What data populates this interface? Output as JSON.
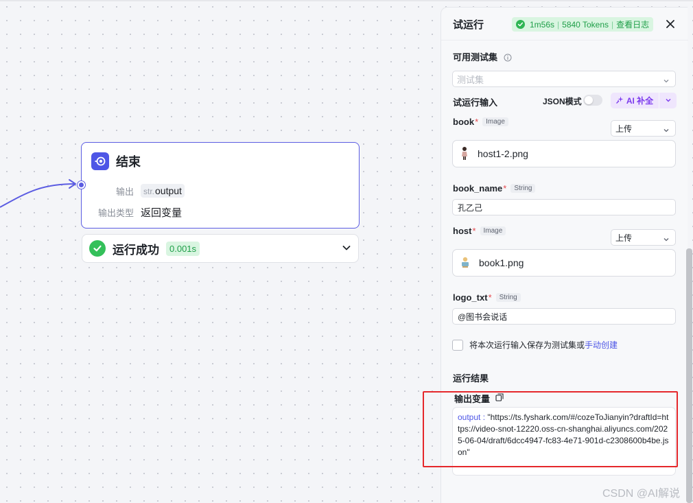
{
  "canvas": {
    "node": {
      "title": "结束",
      "output_label": "输出",
      "output_type_prefix": "str.",
      "output_name": "output",
      "output_kind_label": "输出类型",
      "output_kind_value": "返回变量"
    },
    "status": {
      "text": "运行成功",
      "time": "0.001s"
    }
  },
  "panel": {
    "title": "试运行",
    "badge": {
      "duration": "1m56s",
      "tokens": "5840 Tokens",
      "log_link": "查看日志"
    },
    "testset": {
      "label": "可用测试集",
      "placeholder": "测试集"
    },
    "run_input": {
      "label": "试运行输入",
      "json_mode": "JSON模式",
      "ai_button": "AI 补全"
    },
    "fields": [
      {
        "name": "book",
        "type": "Image",
        "mode": "上传",
        "file": "host1-2.png"
      },
      {
        "name": "book_name",
        "type": "String",
        "value": "孔乙己"
      },
      {
        "name": "host",
        "type": "Image",
        "mode": "上传",
        "file": "book1.png"
      },
      {
        "name": "logo_txt",
        "type": "String",
        "value": "@图书会说话"
      }
    ],
    "save": {
      "text": "将本次运行输入保存为测试集或",
      "link": "手动创建"
    },
    "result": {
      "title": "运行结果",
      "output_var_label": "输出变量",
      "output_key": "output :",
      "output_value": "\"https://ts.fyshark.com/#/cozeToJianyin?draftId=https://video-snot-12220.oss-cn-shanghai.aliyuncs.com/2025-06-04/draft/6dcc4947-fc83-4e71-901d-c2308600b4be.json\""
    }
  },
  "watermark": "CSDN @AI解说",
  "colors": {
    "accent": "#4e56e6",
    "success": "#34c05a",
    "ai_purple": "#7c3bed",
    "highlight_red": "#e5272b"
  }
}
